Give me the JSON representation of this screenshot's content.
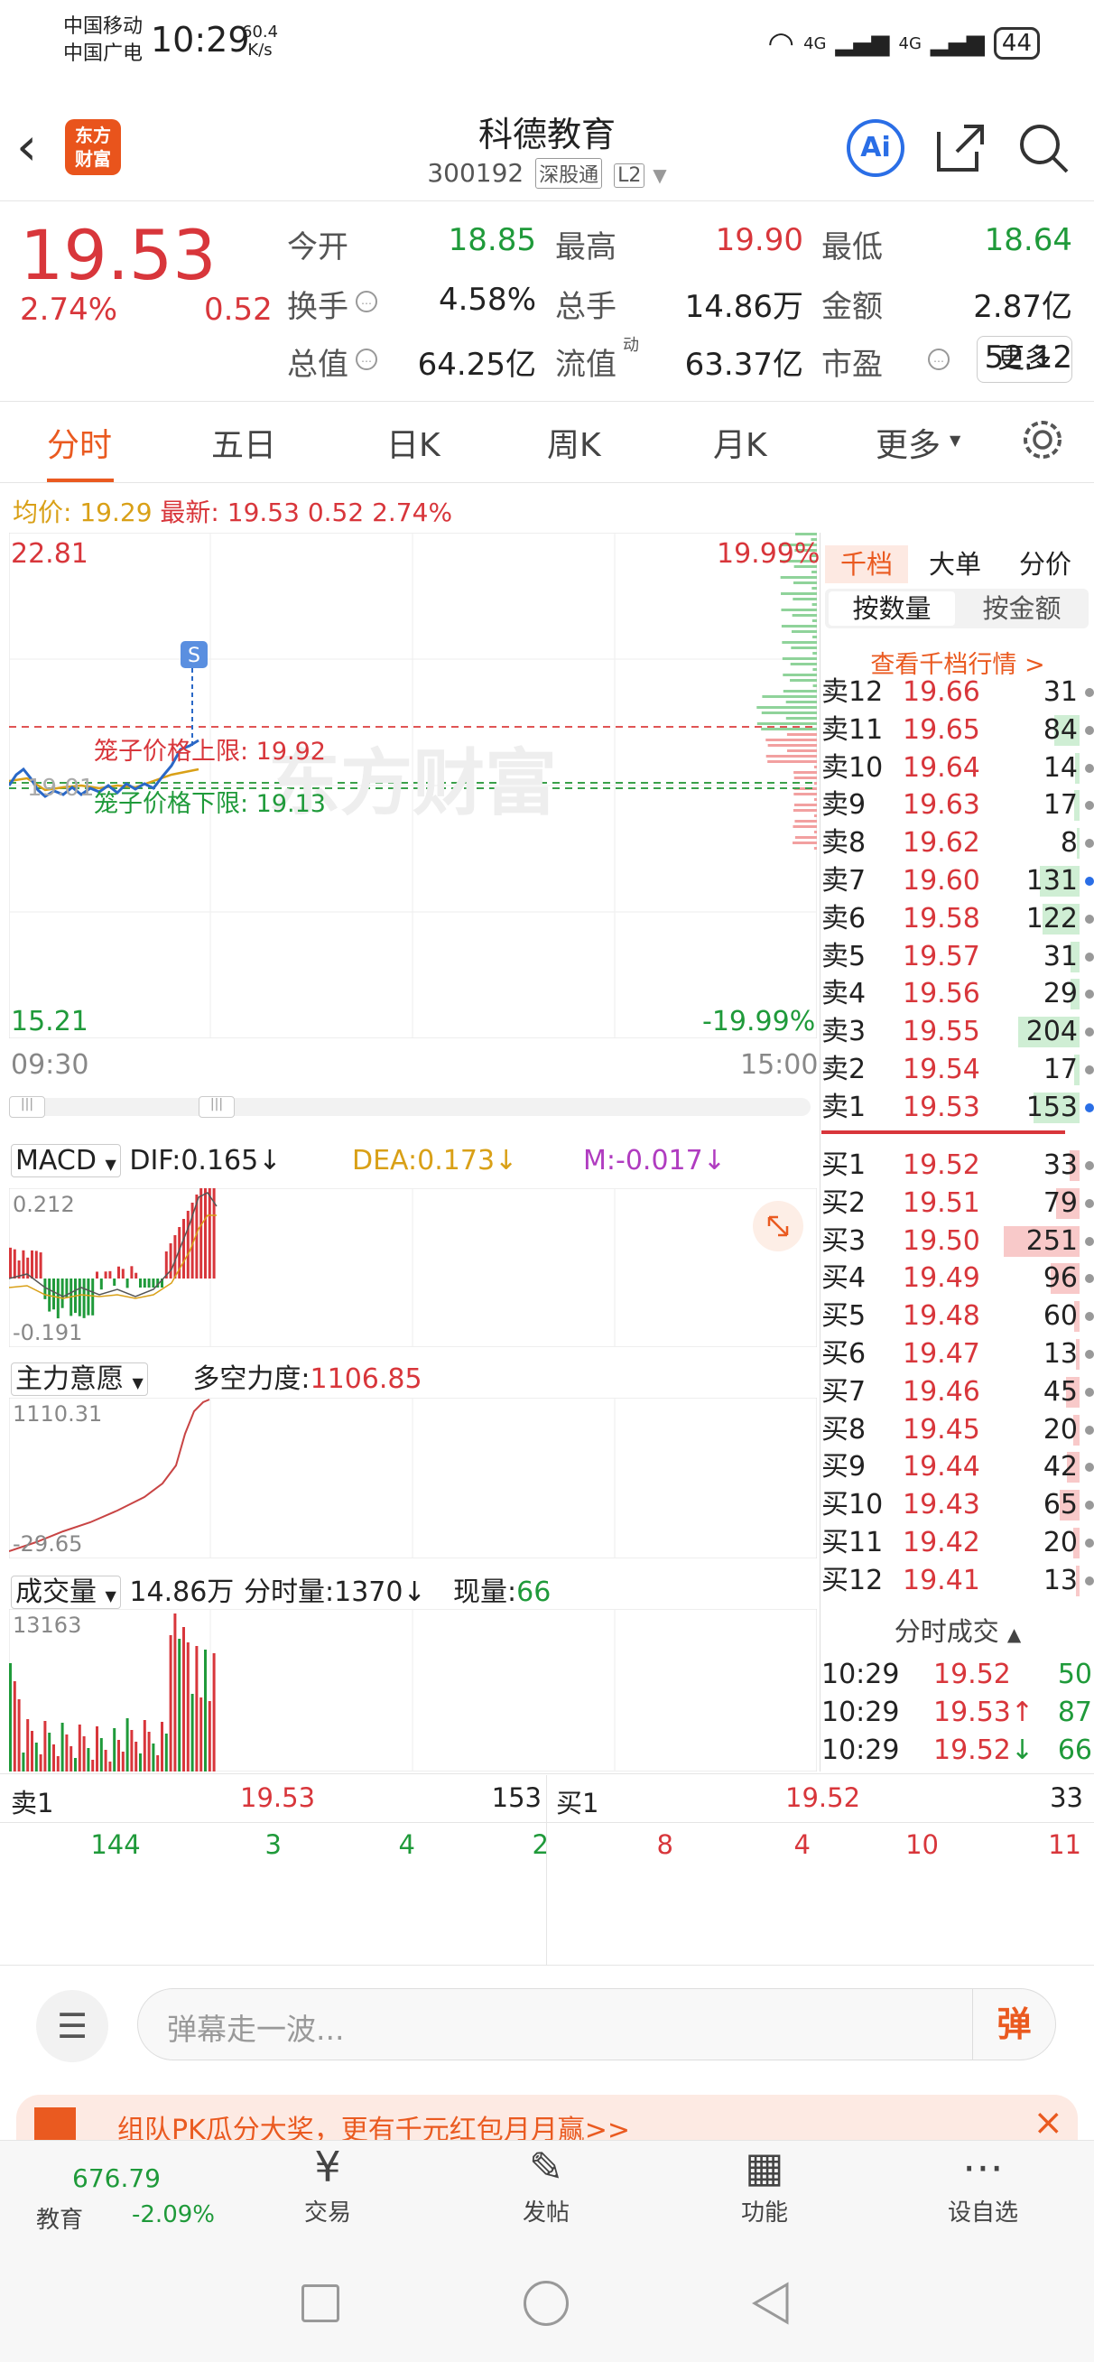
{
  "status": {
    "carrier1": "中国移动",
    "carrier2": "中国广电",
    "time": "10:29",
    "speed": "60.4",
    "speed_unit": "K/s",
    "net1": "4G",
    "net2": "4G",
    "battery": "44"
  },
  "header": {
    "logo": "东方\n财富",
    "title": "科德教育",
    "code": "300192",
    "tag1": "深股通",
    "tag2": "L2"
  },
  "quote": {
    "price": "19.53",
    "pct": "2.74%",
    "chg": "0.52",
    "items": [
      {
        "label": "今开",
        "value": "18.85",
        "vc": "green"
      },
      {
        "label": "最高",
        "value": "19.90",
        "vc": "red"
      },
      {
        "label": "最低",
        "value": "18.64",
        "vc": "green"
      },
      {
        "label": "换手",
        "value": "4.58%",
        "vc": ""
      },
      {
        "label": "总手",
        "value": "14.86万",
        "vc": ""
      },
      {
        "label": "金额",
        "value": "2.87亿",
        "vc": ""
      },
      {
        "label": "总值",
        "value": "64.25亿",
        "vc": ""
      },
      {
        "label": "流值",
        "value": "63.37亿",
        "vc": ""
      },
      {
        "label": "市盈",
        "value": "52.12",
        "vc": ""
      }
    ],
    "pe_sup": "动",
    "more": "更多"
  },
  "tabs": [
    "分时",
    "五日",
    "日K",
    "周K",
    "月K",
    "更多"
  ],
  "intraday": {
    "avg_label": "均价:",
    "avg": "19.29",
    "last_label": "最新:",
    "last": "19.53",
    "chg": "0.52",
    "pct": "2.74%",
    "ymax": "22.81",
    "ymin": "15.21",
    "pmax": "19.99%",
    "pmin": "-19.99%",
    "tstart": "09:30",
    "tend": "15:00",
    "cage_up": "笼子价格上限: 19.92",
    "cage_dn": "笼子价格下限: 19.13",
    "left_mid": "19.01",
    "s_badge": "S",
    "watermark": "东方财富"
  },
  "book_tabs": {
    "a": "千档",
    "b": "大单",
    "c": "分价",
    "d": "按数量",
    "e": "按金额",
    "link": "查看千档行情 >"
  },
  "asks": [
    {
      "n": "卖12",
      "p": "19.66",
      "v": "31",
      "w": 0
    },
    {
      "n": "卖11",
      "p": "19.65",
      "v": "84",
      "w": 28
    },
    {
      "n": "卖10",
      "p": "19.64",
      "v": "14",
      "w": 5
    },
    {
      "n": "卖9",
      "p": "19.63",
      "v": "17",
      "w": 6
    },
    {
      "n": "卖8",
      "p": "19.62",
      "v": "8",
      "w": 3
    },
    {
      "n": "卖7",
      "p": "19.60",
      "v": "131",
      "w": 44
    },
    {
      "n": "卖6",
      "p": "19.58",
      "v": "122",
      "w": 41
    },
    {
      "n": "卖5",
      "p": "19.57",
      "v": "31",
      "w": 10
    },
    {
      "n": "卖4",
      "p": "19.56",
      "v": "29",
      "w": 10
    },
    {
      "n": "卖3",
      "p": "19.55",
      "v": "204",
      "w": 68
    },
    {
      "n": "卖2",
      "p": "19.54",
      "v": "17",
      "w": 6
    },
    {
      "n": "卖1",
      "p": "19.53",
      "v": "153",
      "w": 51
    }
  ],
  "bids": [
    {
      "n": "买1",
      "p": "19.52",
      "v": "33",
      "w": 11
    },
    {
      "n": "买2",
      "p": "19.51",
      "v": "79",
      "w": 26
    },
    {
      "n": "买3",
      "p": "19.50",
      "v": "251",
      "w": 84
    },
    {
      "n": "买4",
      "p": "19.49",
      "v": "96",
      "w": 32
    },
    {
      "n": "买5",
      "p": "19.48",
      "v": "60",
      "w": 6
    },
    {
      "n": "买6",
      "p": "19.47",
      "v": "13",
      "w": 4
    },
    {
      "n": "买7",
      "p": "19.46",
      "v": "45",
      "w": 15
    },
    {
      "n": "买8",
      "p": "19.45",
      "v": "20",
      "w": 7
    },
    {
      "n": "买9",
      "p": "19.44",
      "v": "42",
      "w": 14
    },
    {
      "n": "买10",
      "p": "19.43",
      "v": "65",
      "w": 22
    },
    {
      "n": "买11",
      "p": "19.42",
      "v": "20",
      "w": 7
    },
    {
      "n": "买12",
      "p": "19.41",
      "v": "13",
      "w": 4
    }
  ],
  "ticks_title": "分时成交",
  "ticks": [
    {
      "t": "10:29",
      "p": "19.52",
      "a": "",
      "v": "50",
      "c": "green"
    },
    {
      "t": "10:29",
      "p": "19.53",
      "a": "↑",
      "v": "87",
      "c": "green"
    },
    {
      "t": "10:29",
      "p": "19.52",
      "a": "↓",
      "v": "66",
      "c": "green"
    }
  ],
  "macd": {
    "name": "MACD",
    "dif": "DIF:0.165↓",
    "dea": "DEA:0.173↓",
    "m": "M:-0.017↓",
    "top": "0.212",
    "bot": "-0.191"
  },
  "force": {
    "name": "主力意愿",
    "label": "多空力度:",
    "value": "1106.85",
    "top": "1110.31",
    "bot": "-29.65"
  },
  "vol": {
    "name": "成交量",
    "total": "14.86万",
    "fen": "分时量:1370↓",
    "now_label": "现量:",
    "now": "66",
    "top": "13163"
  },
  "queue": {
    "sell_label": "卖1",
    "sell_price": "19.53",
    "sell_vol": "153",
    "buy_label": "买1",
    "buy_price": "19.52",
    "buy_vol": "33",
    "sell_q": [
      "144",
      "3",
      "4",
      "2"
    ],
    "buy_q": [
      "8",
      "4",
      "10",
      "11"
    ]
  },
  "chat": {
    "placeholder": "弹幕走一波...",
    "danmu": "弹"
  },
  "banner": {
    "text": "组队PK瓜分大奖，更有千元红包月月赢>>"
  },
  "nav": {
    "index_val": "676.79",
    "index_name": "教育",
    "index_pct": "-2.09%",
    "items": [
      "交易",
      "发帖",
      "功能",
      "设自选"
    ]
  },
  "colors": {
    "accent": "#ea5a20",
    "up": "#d8363b",
    "down": "#1f9a3a",
    "avg": "#d9a017"
  }
}
